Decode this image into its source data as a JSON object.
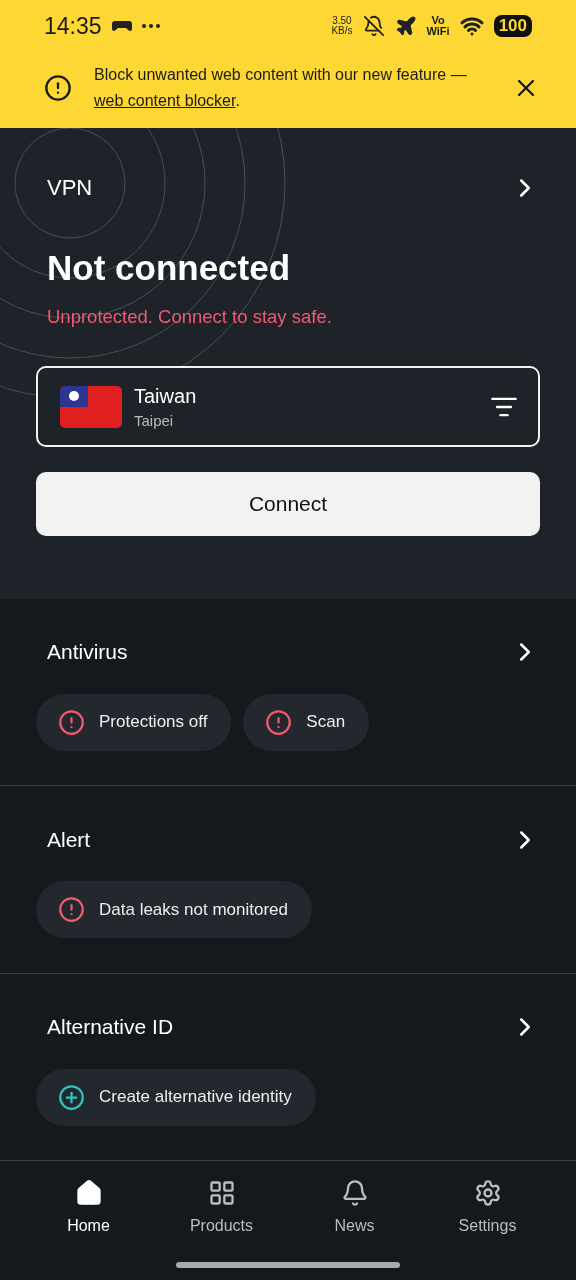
{
  "status_bar": {
    "time": "14:35",
    "speed_value": "3.50",
    "speed_unit": "KB/s",
    "volte_top": "Vo",
    "volte_bottom": "WiFi",
    "battery": "100"
  },
  "banner": {
    "text": "Block unwanted web content with our new feature — ",
    "link": "web content blocker",
    "suffix": "."
  },
  "vpn": {
    "label": "VPN",
    "status": "Not connected",
    "message": "Unprotected. Connect to stay safe.",
    "location": {
      "country": "Taiwan",
      "city": "Taipei"
    },
    "button": "Connect"
  },
  "sections": [
    {
      "title": "Antivirus",
      "pills": [
        {
          "kind": "warning",
          "label": "Protections off"
        },
        {
          "kind": "warning",
          "label": "Scan"
        }
      ]
    },
    {
      "title": "Alert",
      "pills": [
        {
          "kind": "warning",
          "label": "Data leaks not monitored"
        }
      ]
    },
    {
      "title": "Alternative ID",
      "pills": [
        {
          "kind": "add",
          "label": "Create alternative identity"
        }
      ]
    }
  ],
  "nav": [
    {
      "kind": "home",
      "label": "Home",
      "selected": true
    },
    {
      "kind": "products",
      "label": "Products",
      "selected": false
    },
    {
      "kind": "news",
      "label": "News",
      "selected": false
    },
    {
      "kind": "settings",
      "label": "Settings",
      "selected": false
    }
  ]
}
